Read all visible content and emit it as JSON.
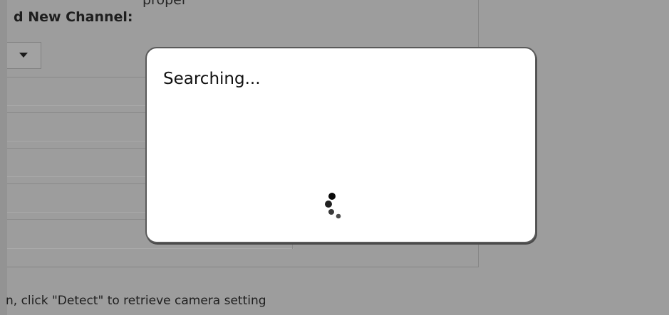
{
  "background": {
    "top_cut_text": "proper"
  },
  "panel": {
    "title": "d New Channel:",
    "select_arrow_icon": "chevron-down-icon",
    "hint": "n, click \"Detect\" to retrieve camera setting"
  },
  "dialog": {
    "title": "Searching...",
    "spinner_icon": "loading-spinner-icon"
  },
  "colors": {
    "overlay": "#9d9d9d",
    "dialog_bg": "#ffffff",
    "dialog_border": "#5a5a5a",
    "text": "#1e1e1e"
  }
}
